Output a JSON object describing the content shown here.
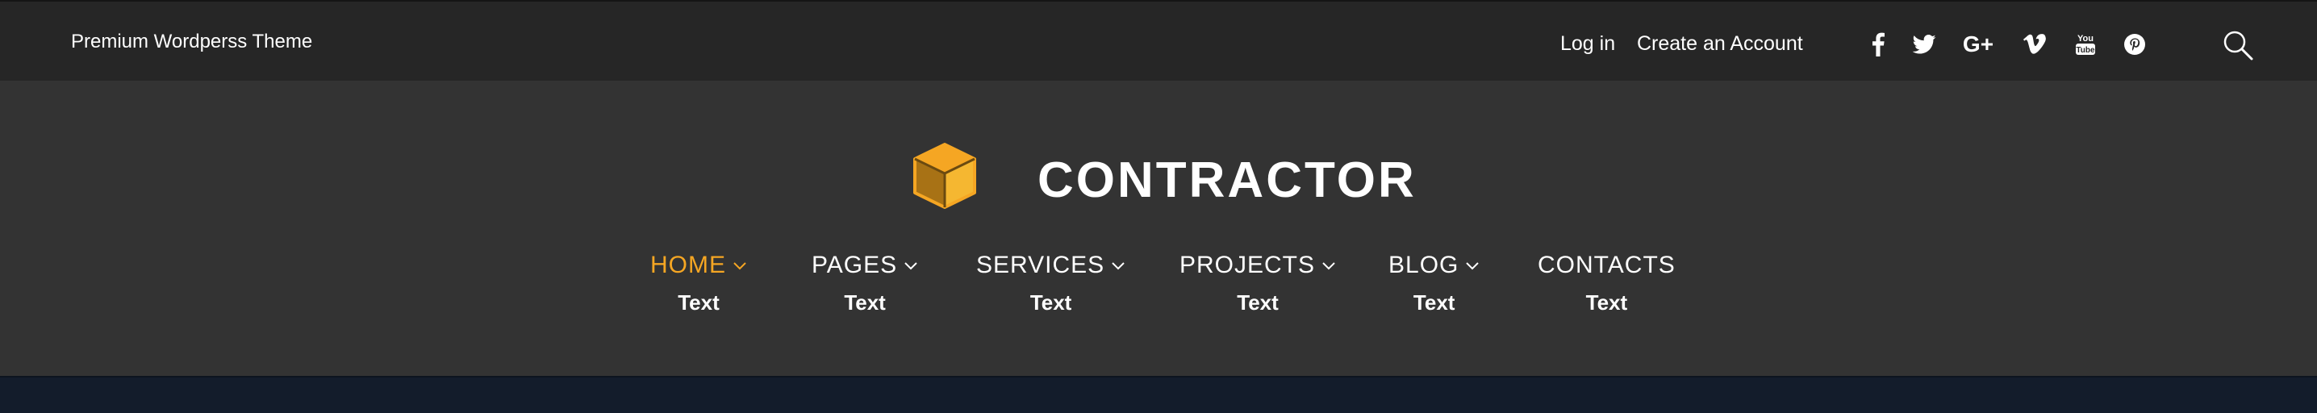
{
  "topbar": {
    "tagline": "Premium Wordperss Theme",
    "login_label": "Log in",
    "register_label": "Create an Account",
    "social": [
      "facebook-icon",
      "twitter-icon",
      "google-plus-icon",
      "vimeo-icon",
      "youtube-icon",
      "pinterest-icon"
    ],
    "search_icon": "search-icon"
  },
  "brand": {
    "logo_icon": "cube-icon",
    "name": "CONTRACTOR",
    "accent_color": "#f5a623"
  },
  "nav": {
    "items": [
      {
        "label": "HOME",
        "sub": "Text",
        "active": true
      },
      {
        "label": "PAGES",
        "sub": "Text",
        "active": false
      },
      {
        "label": "SERVICES",
        "sub": "Text",
        "active": false
      },
      {
        "label": "PROJECTS",
        "sub": "Text",
        "active": false
      },
      {
        "label": "BLOG",
        "sub": "Text",
        "active": false
      },
      {
        "label": "CONTACTS",
        "sub": "Text",
        "active": false
      }
    ]
  }
}
